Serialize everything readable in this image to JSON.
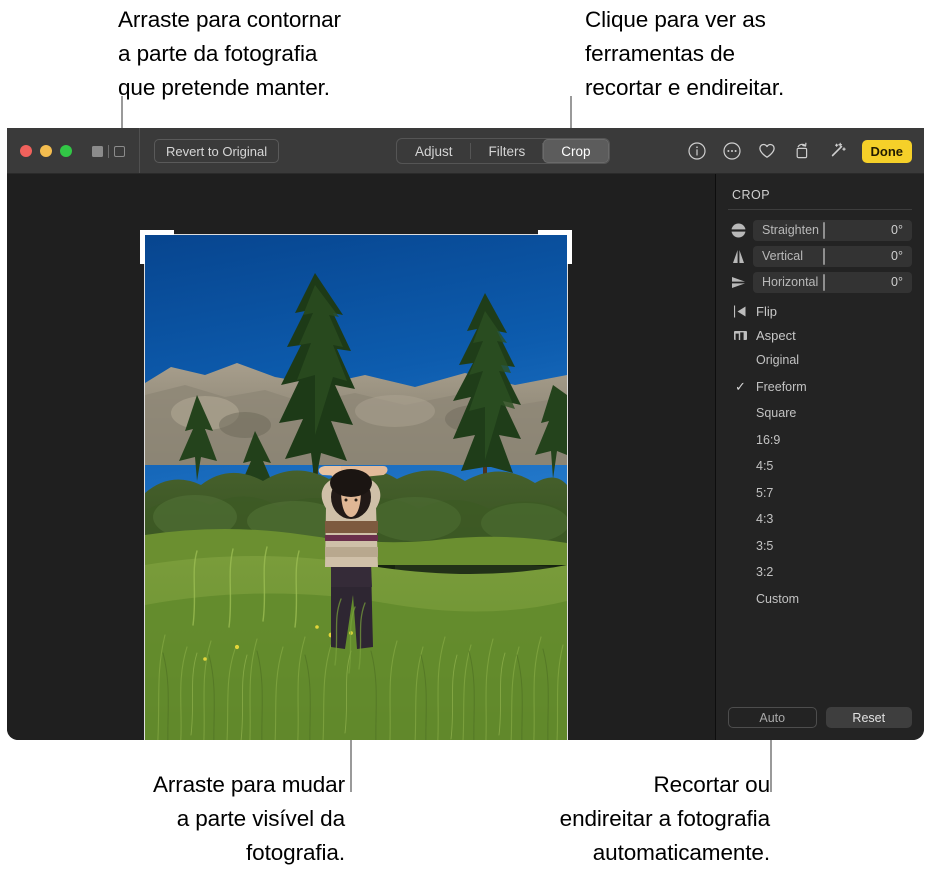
{
  "callouts": {
    "drag_outline": "Arraste para contornar\na parte da fotografia\nque pretende manter.",
    "click_tools": "Clique para ver as\nferramentas de\nrecortar e endireitar.",
    "drag_visible": "Arraste para mudar\na parte visível da\nfotografia.",
    "auto_crop": "Recortar ou\nendireitar a fotografia\nautomaticamente."
  },
  "toolbar": {
    "revert_label": "Revert to Original",
    "segments": [
      {
        "label": "Adjust",
        "active": false
      },
      {
        "label": "Filters",
        "active": false
      },
      {
        "label": "Crop",
        "active": true
      }
    ],
    "done_label": "Done",
    "icons": [
      "info-icon",
      "more-options-icon",
      "favorite-heart-icon",
      "rotate-icon",
      "enhance-magic-wand-icon"
    ],
    "window_buttons": [
      "close-button",
      "minimize-button",
      "zoom-button"
    ],
    "sidebar_toggle_icons": [
      "sidebar-filled-icon",
      "sidebar-outline-icon"
    ]
  },
  "inspector": {
    "title": "CROP",
    "sliders": [
      {
        "icon": "straighten-icon",
        "label": "Straighten",
        "value": "0°"
      },
      {
        "icon": "vertical-perspective-icon",
        "label": "Vertical",
        "value": "0°"
      },
      {
        "icon": "horizontal-perspective-icon",
        "label": "Horizontal",
        "value": "0°"
      }
    ],
    "flip": {
      "icon": "flip-icon",
      "label": "Flip"
    },
    "aspect": {
      "icon": "aspect-icon",
      "label": "Aspect"
    },
    "aspect_options": [
      {
        "label": "Original",
        "selected": false
      },
      {
        "label": "Freeform",
        "selected": true
      },
      {
        "label": "Square",
        "selected": false
      },
      {
        "label": "16:9",
        "selected": false
      },
      {
        "label": "4:5",
        "selected": false
      },
      {
        "label": "5:7",
        "selected": false
      },
      {
        "label": "4:3",
        "selected": false
      },
      {
        "label": "3:5",
        "selected": false
      },
      {
        "label": "3:2",
        "selected": false
      },
      {
        "label": "Custom",
        "selected": false
      }
    ],
    "check_glyph": "✓",
    "auto_label": "Auto",
    "reset_label": "Reset"
  },
  "photo": {
    "description": "Pessoa de pé num prado de erva alta com as mãos acima da cabeça, com árvores de pinheiro, afloramentos rochosos e um lago ao fundo sob um céu azul.",
    "colors": {
      "sky_top": "#0a5bb0",
      "sky_bottom": "#1a6fc4",
      "tree_green": "#1f3c1c",
      "rock": "#9a9384",
      "grass": "#6f9338",
      "water": "#16220f",
      "skin": "#e8c0a0",
      "shirt": "#cdbba6",
      "pants": "#2e2430"
    }
  },
  "theme": {
    "window_bg": "#1e1e1e",
    "toolbar_bg": "#3a3a3a",
    "inspector_bg": "#232323",
    "accent_yellow": "#f5d029",
    "canvas_bg": "#1f1f1f"
  }
}
